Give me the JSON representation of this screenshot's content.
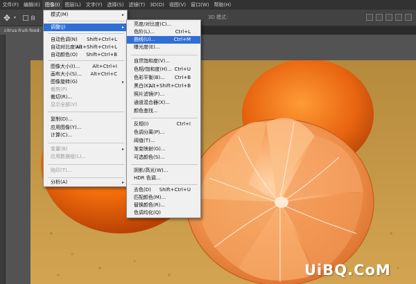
{
  "menubar": {
    "items": [
      {
        "label": "文件(F)"
      },
      {
        "label": "编辑(E)"
      },
      {
        "label": "图像(I)",
        "active": true
      },
      {
        "label": "图层(L)"
      },
      {
        "label": "文字(Y)"
      },
      {
        "label": "选择(S)"
      },
      {
        "label": "滤镜(T)"
      },
      {
        "label": "3D(D)"
      },
      {
        "label": "视图(V)"
      },
      {
        "label": "窗口(W)"
      },
      {
        "label": "帮助(H)"
      }
    ]
  },
  "options_bar": {
    "auto_select_label": "自",
    "mode_3d_label": "3D 模式:"
  },
  "document_tab": {
    "label": "citrus-fruit-food-"
  },
  "image_menu": {
    "items": [
      {
        "label": "模式(M)",
        "submenu": "▸"
      },
      {
        "label": "调整(J)",
        "submenu": "▸",
        "highlighted": true
      },
      {
        "label": "自动色调(N)",
        "shortcut": "Shift+Ctrl+L"
      },
      {
        "label": "自动对比度(U)",
        "shortcut": "Alt+Shift+Ctrl+L"
      },
      {
        "label": "自动颜色(O)",
        "shortcut": "Shift+Ctrl+B"
      },
      {
        "label": "图像大小(I)...",
        "shortcut": "Alt+Ctrl+I"
      },
      {
        "label": "画布大小(S)...",
        "shortcut": "Alt+Ctrl+C"
      },
      {
        "label": "图像旋转(G)",
        "submenu": "▸"
      },
      {
        "label": "裁剪(P)",
        "disabled": true
      },
      {
        "label": "裁切(R)..."
      },
      {
        "label": "显示全部(V)",
        "disabled": true
      },
      {
        "label": "复制(D)..."
      },
      {
        "label": "应用图像(Y)..."
      },
      {
        "label": "计算(C)..."
      },
      {
        "label": "变量(B)",
        "submenu": "▸",
        "disabled": true
      },
      {
        "label": "应用数据组(L)...",
        "disabled": true
      },
      {
        "label": "陷印(T)...",
        "disabled": true
      },
      {
        "label": "分析(A)",
        "submenu": "▸"
      }
    ]
  },
  "adjust_menu": {
    "items": [
      {
        "label": "亮度/对比度(C)..."
      },
      {
        "label": "色阶(L)...",
        "shortcut": "Ctrl+L"
      },
      {
        "label": "曲线(U)...",
        "shortcut": "Ctrl+M",
        "highlighted": true
      },
      {
        "label": "曝光度(E)..."
      },
      {
        "label": "自然饱和度(V)..."
      },
      {
        "label": "色相/饱和度(H)...",
        "shortcut": "Ctrl+U"
      },
      {
        "label": "色彩平衡(B)...",
        "shortcut": "Ctrl+B"
      },
      {
        "label": "黑白(K)...",
        "shortcut": "Alt+Shift+Ctrl+B"
      },
      {
        "label": "照片滤镜(F)..."
      },
      {
        "label": "通道混合器(X)..."
      },
      {
        "label": "颜色查找..."
      },
      {
        "label": "反相(I)",
        "shortcut": "Ctrl+I"
      },
      {
        "label": "色调分离(P)..."
      },
      {
        "label": "阈值(T)..."
      },
      {
        "label": "渐变映射(G)..."
      },
      {
        "label": "可选颜色(S)..."
      },
      {
        "label": "阴影/高光(W)..."
      },
      {
        "label": "HDR 色调..."
      },
      {
        "label": "去色(D)",
        "shortcut": "Shift+Ctrl+U"
      },
      {
        "label": "匹配颜色(M)..."
      },
      {
        "label": "替换颜色(R)..."
      },
      {
        "label": "色调均化(Q)"
      }
    ]
  },
  "watermark": {
    "text": "UiBQ.CoM"
  },
  "colors": {
    "menu_highlight": "#2f6fd6",
    "menubar_bg": "#323232",
    "workspace_bg": "#535353"
  }
}
